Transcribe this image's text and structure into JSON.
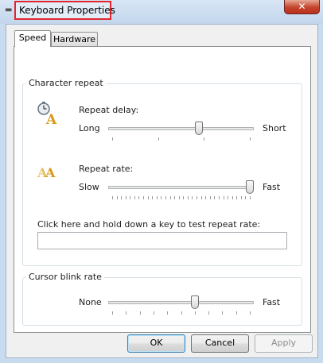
{
  "window": {
    "title": "Keyboard Properties",
    "close_symbol": "✕"
  },
  "tabs": [
    {
      "label": "Speed",
      "active": true
    },
    {
      "label": "Hardware",
      "active": false
    }
  ],
  "character_repeat": {
    "group_label": "Character repeat",
    "repeat_delay": {
      "label": "Repeat delay:",
      "min_label": "Long",
      "max_label": "Short",
      "icon": "clock-letter-icon",
      "value_fraction": 0.63
    },
    "repeat_rate": {
      "label": "Repeat rate:",
      "min_label": "Slow",
      "max_label": "Fast",
      "icon": "double-letter-icon",
      "value_fraction": 1.0
    },
    "test_prompt": "Click here and hold down a key to test repeat rate:",
    "test_value": ""
  },
  "cursor_blink": {
    "group_label": "Cursor blink rate",
    "min_label": "None",
    "max_label": "Fast",
    "value_fraction": 0.6
  },
  "buttons": {
    "ok": "OK",
    "cancel": "Cancel",
    "apply": "Apply"
  },
  "colors": {
    "highlight_border": "#e0262e",
    "close_button": "#c5432c"
  }
}
